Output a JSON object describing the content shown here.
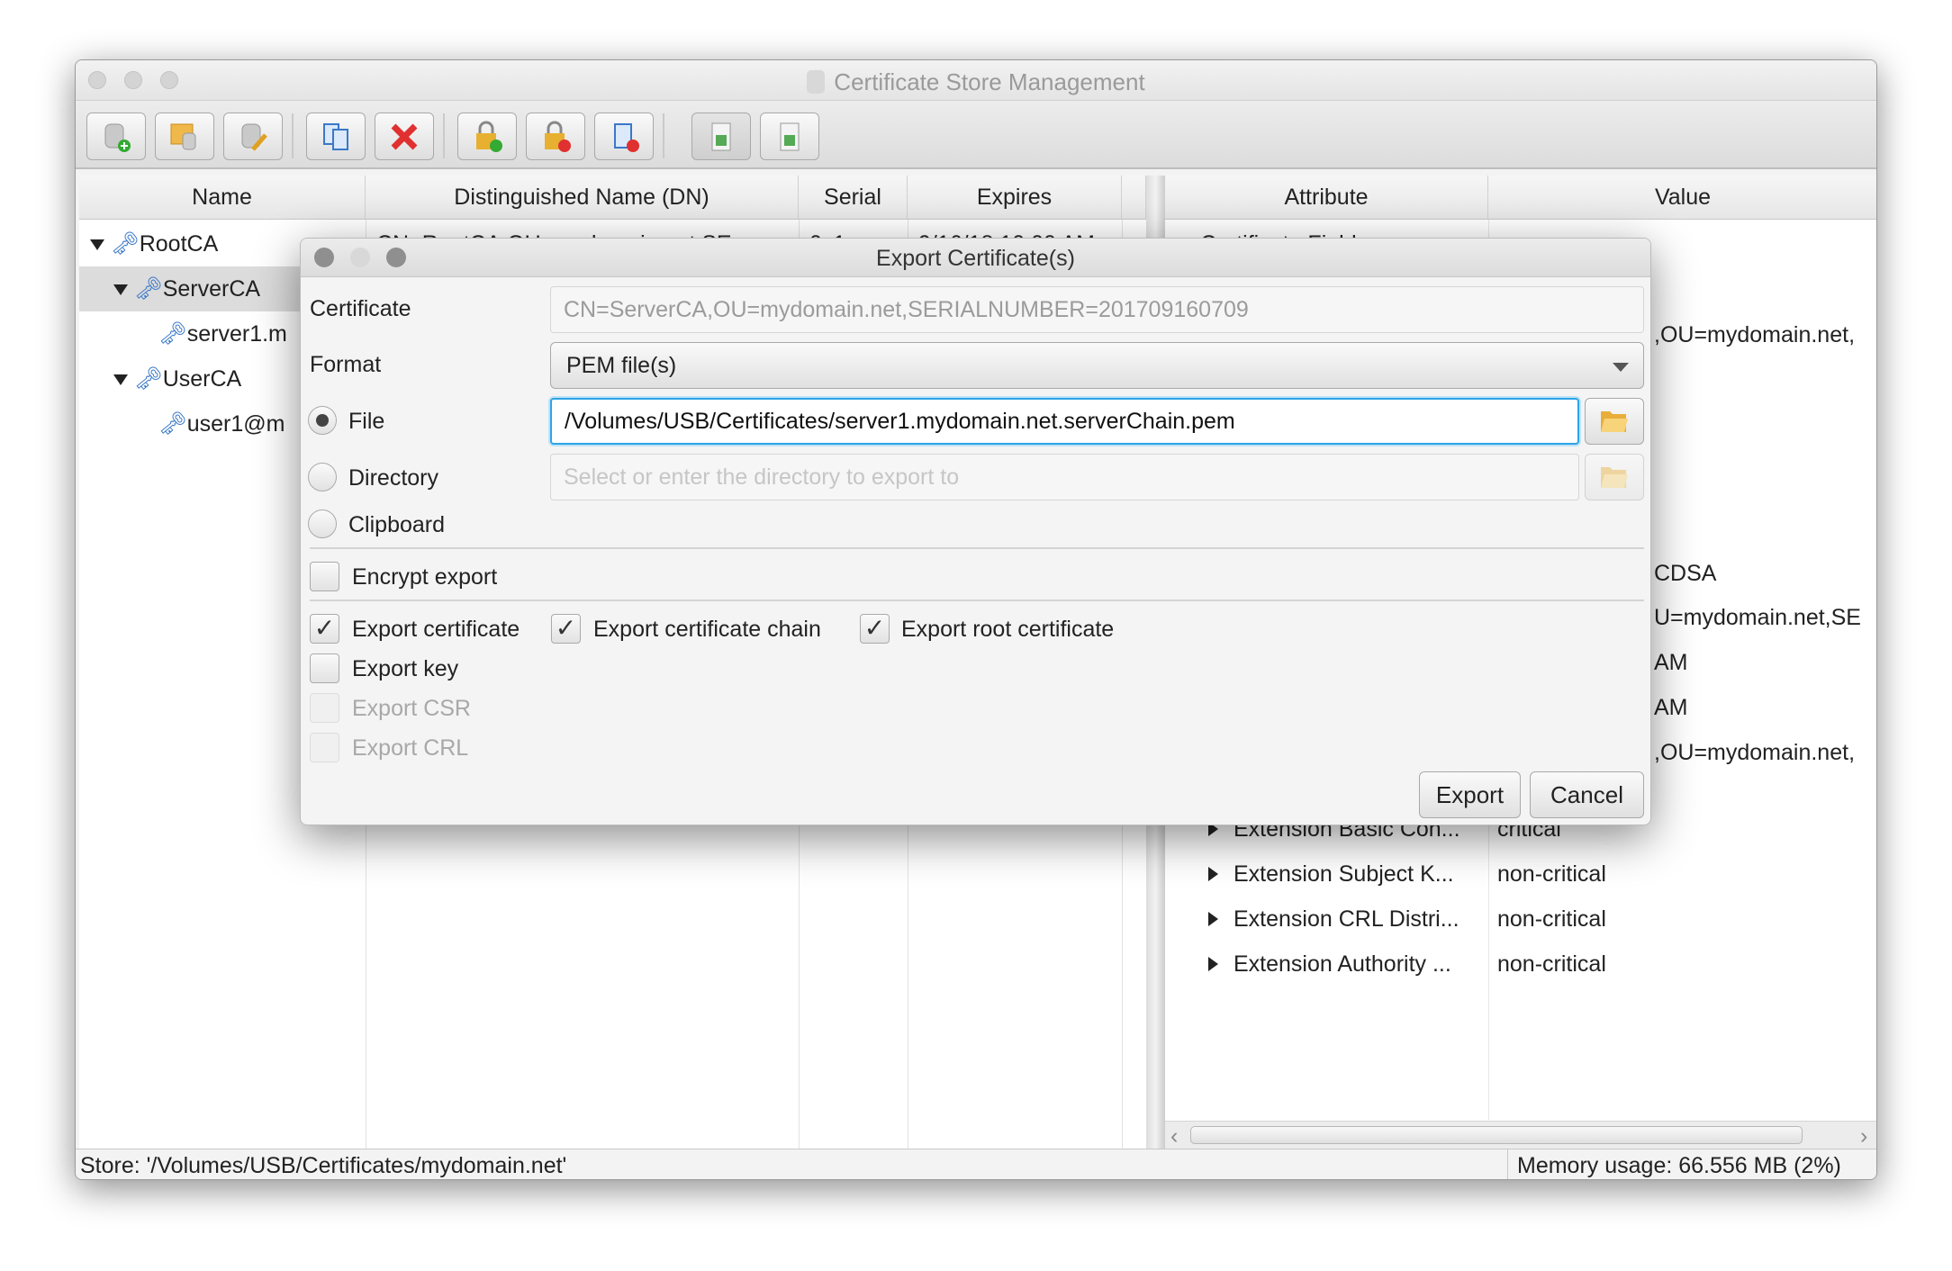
{
  "window": {
    "title": "Certificate Store Management"
  },
  "toolbar": {
    "buttons": [
      {
        "name": "new-store-icon"
      },
      {
        "name": "open-store-icon"
      },
      {
        "name": "edit-store-icon"
      },
      {
        "name": "copy-icon"
      },
      {
        "name": "delete-icon"
      },
      {
        "name": "lock-add-icon"
      },
      {
        "name": "lock-remove-icon"
      },
      {
        "name": "certificate-remove-icon"
      },
      {
        "name": "import-icon"
      },
      {
        "name": "export-icon"
      }
    ]
  },
  "table": {
    "headers": {
      "name": "Name",
      "dn": "Distinguished Name (DN)",
      "serial": "Serial",
      "expires": "Expires"
    },
    "rows": [
      {
        "name": "RootCA",
        "dn": "CN=RootCA,OU=mydomain.net,SE",
        "serial": "0x1",
        "expires": "9/16/18 10:00 AM"
      },
      {
        "name": "ServerCA"
      },
      {
        "name": "server1.m"
      },
      {
        "name": "UserCA"
      },
      {
        "name": "user1@m"
      }
    ]
  },
  "details": {
    "headers": {
      "attribute": "Attribute",
      "value": "Value"
    },
    "first_row": "Certificate Fields",
    "value_fragments": [
      ",OU=mydomain.net,",
      "CDSA",
      "U=mydomain.net,SE",
      "AM",
      "AM",
      ",OU=mydomain.net,"
    ],
    "rows": [
      {
        "attribute": "Extension Basic Con...",
        "value": "critical"
      },
      {
        "attribute": "Extension Subject K...",
        "value": "non-critical"
      },
      {
        "attribute": "Extension CRL Distri...",
        "value": "non-critical"
      },
      {
        "attribute": "Extension Authority ...",
        "value": "non-critical"
      }
    ]
  },
  "status": {
    "store": "Store: '/Volumes/USB/Certificates/mydomain.net'",
    "memory": "Memory usage: 66.556 MB (2%)"
  },
  "dialog": {
    "title": "Export Certificate(s)",
    "certificate_label": "Certificate",
    "certificate_value": "CN=ServerCA,OU=mydomain.net,SERIALNUMBER=201709160709",
    "format_label": "Format",
    "format_value": "PEM file(s)",
    "file_label": "File",
    "file_value": "/Volumes/USB/Certificates/server1.mydomain.net.serverChain.pem",
    "directory_label": "Directory",
    "directory_placeholder": "Select or enter the directory to export to",
    "clipboard_label": "Clipboard",
    "selected_destination": "File",
    "encrypt_label": "Encrypt export",
    "encrypt_checked": false,
    "export_certificate": "Export certificate",
    "export_certificate_checked": true,
    "export_chain": "Export certificate chain",
    "export_chain_checked": true,
    "export_root": "Export root certificate",
    "export_root_checked": true,
    "export_key": "Export key",
    "export_key_checked": false,
    "export_csr": "Export CSR",
    "export_crl": "Export CRL",
    "export_button": "Export",
    "cancel_button": "Cancel"
  }
}
